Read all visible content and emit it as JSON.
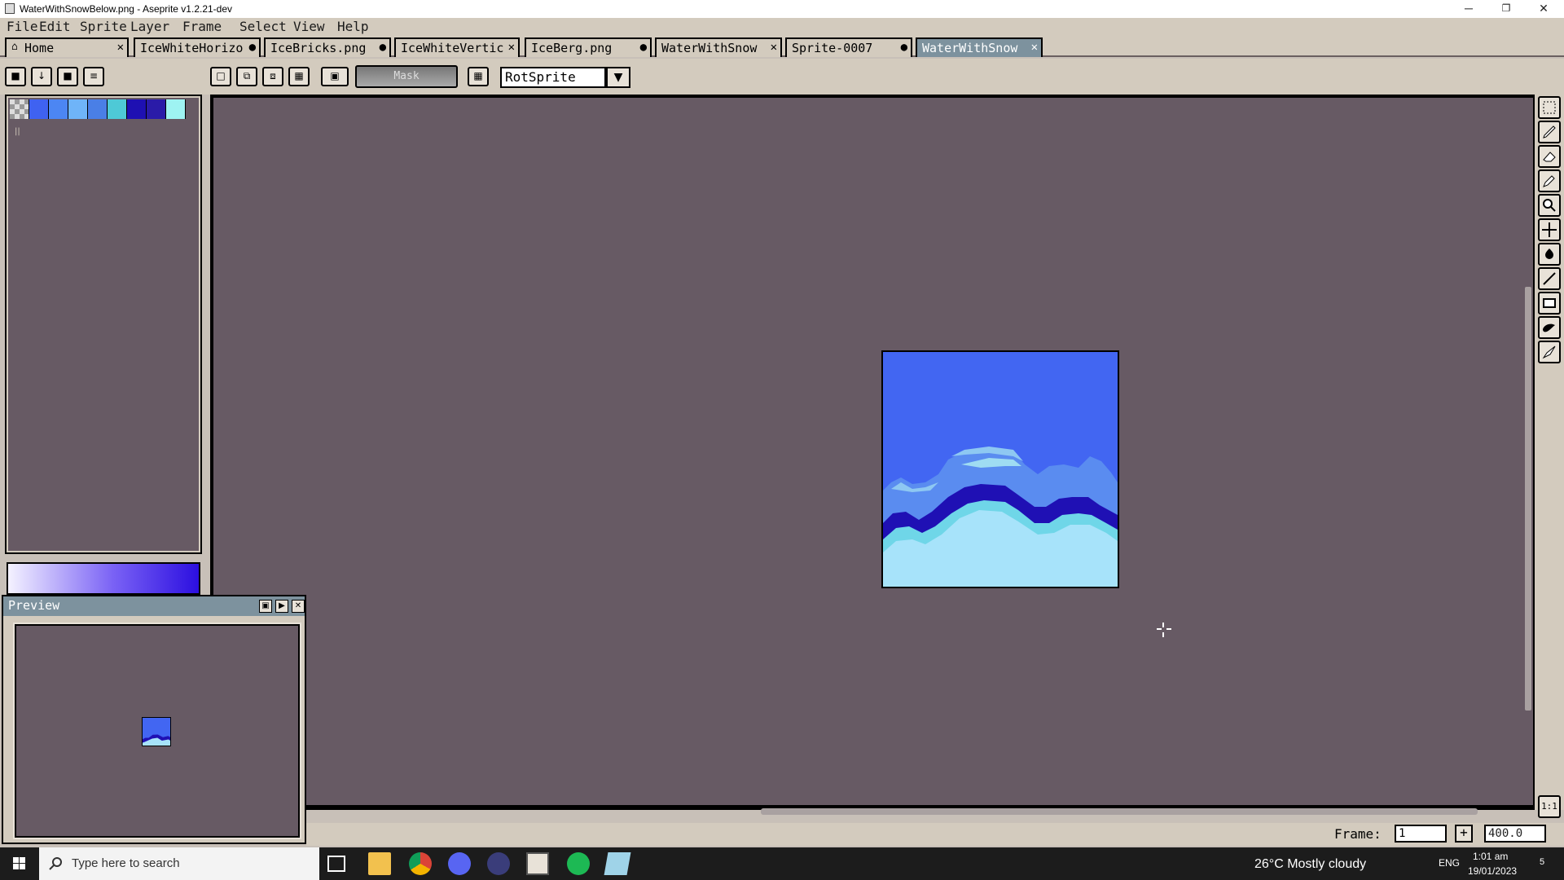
{
  "window": {
    "title": "WaterWithSnowBelow.png - Aseprite v1.2.21-dev",
    "minimize": "─",
    "restore": "❐",
    "close": "✕"
  },
  "menu": [
    "File",
    "Edit",
    "Sprite",
    "Layer",
    "Frame",
    "Select",
    "View",
    "Help"
  ],
  "tabs": [
    {
      "label": "Home",
      "control": "✕"
    },
    {
      "label": "IceWhiteHorizo",
      "control": "●"
    },
    {
      "label": "IceBricks.png",
      "control": "●"
    },
    {
      "label": "IceWhiteVertic",
      "control": "✕"
    },
    {
      "label": "IceBerg.png",
      "control": "●"
    },
    {
      "label": "WaterWithSnow",
      "control": "✕"
    },
    {
      "label": "Sprite-0007",
      "control": "●"
    },
    {
      "label": "WaterWithSnow",
      "control": "✕",
      "active": true
    }
  ],
  "toolbar": {
    "mask_label": "Mask",
    "resize_method": "RotSprite"
  },
  "palette": {
    "colors": [
      "#3f62f1",
      "#4c86f3",
      "#6fb4f8",
      "#4a7fe6",
      "#4ec9d6",
      "#1e10b2",
      "#2a1ba8",
      "#9ef3f2"
    ],
    "mark": "||"
  },
  "preview": {
    "title": "Preview"
  },
  "status": {
    "frame_label": "Frame:",
    "frame_value": "1",
    "add_frame": "+",
    "zoom_value": "400.0",
    "one_to_one": "1:1"
  },
  "taskbar": {
    "search_placeholder": "Type here to search",
    "weather": "26°C  Mostly cloudy",
    "language": "ENG",
    "time": "1:01 am",
    "date": "19/01/2023",
    "notifications": "5"
  }
}
